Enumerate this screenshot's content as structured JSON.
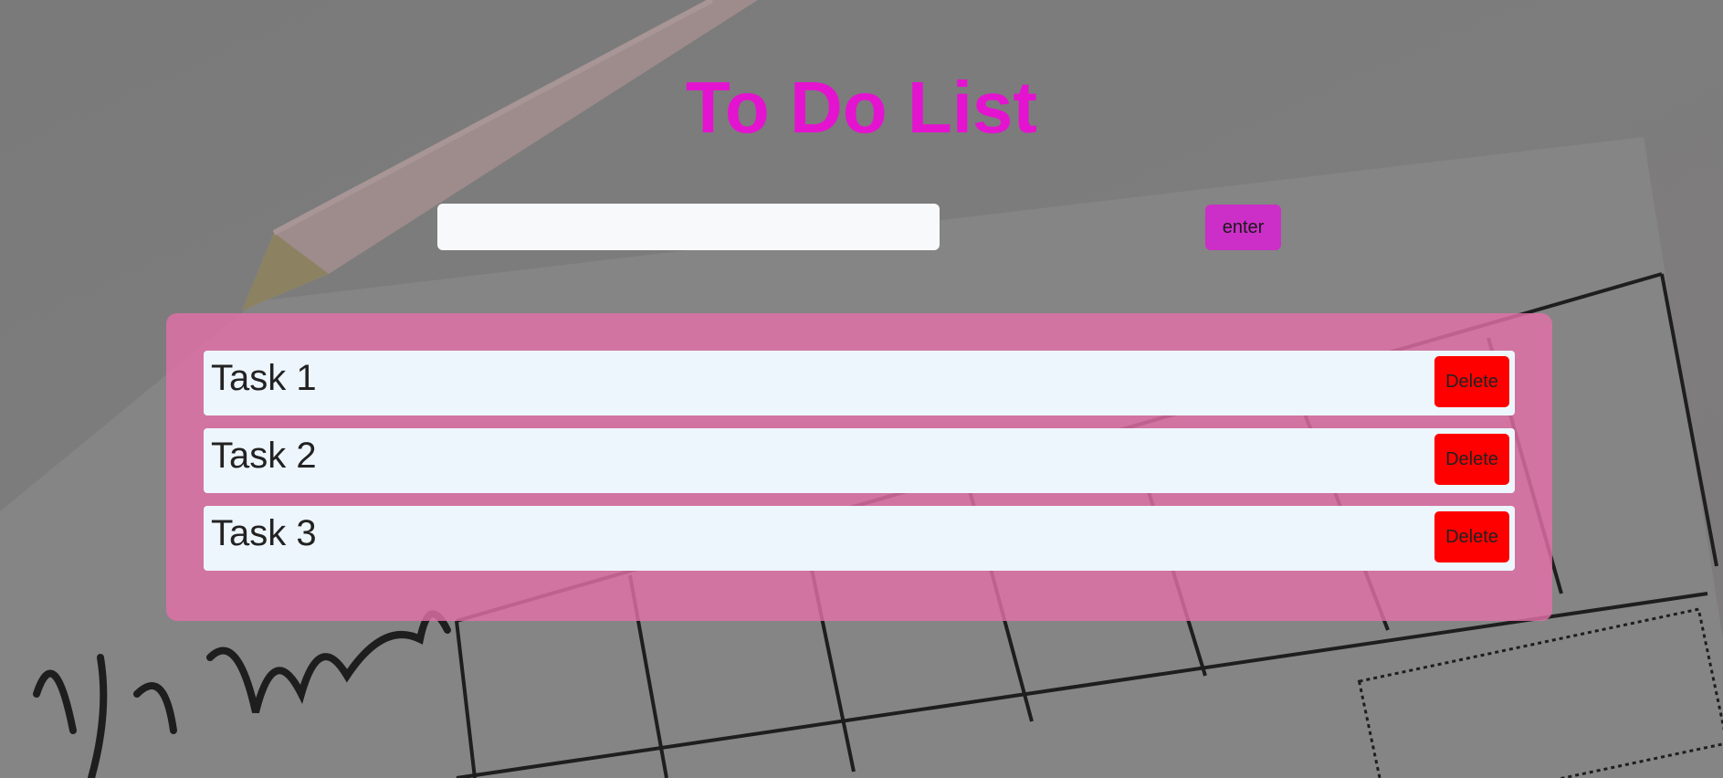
{
  "header": {
    "title": "To Do List",
    "title_color": "#e413cf"
  },
  "input": {
    "value": "",
    "placeholder": ""
  },
  "enter_button": {
    "label": "enter",
    "color": "#cc2ec8"
  },
  "tasks": [
    {
      "label": "Task 1",
      "delete_label": "Delete"
    },
    {
      "label": "Task 2",
      "delete_label": "Delete"
    },
    {
      "label": "Task 3",
      "delete_label": "Delete"
    }
  ],
  "colors": {
    "panel": "#e270a8",
    "task_row": "#eef6fd",
    "delete_button": "#ff0000"
  },
  "background": {
    "description_icon": "planner-background-image"
  }
}
